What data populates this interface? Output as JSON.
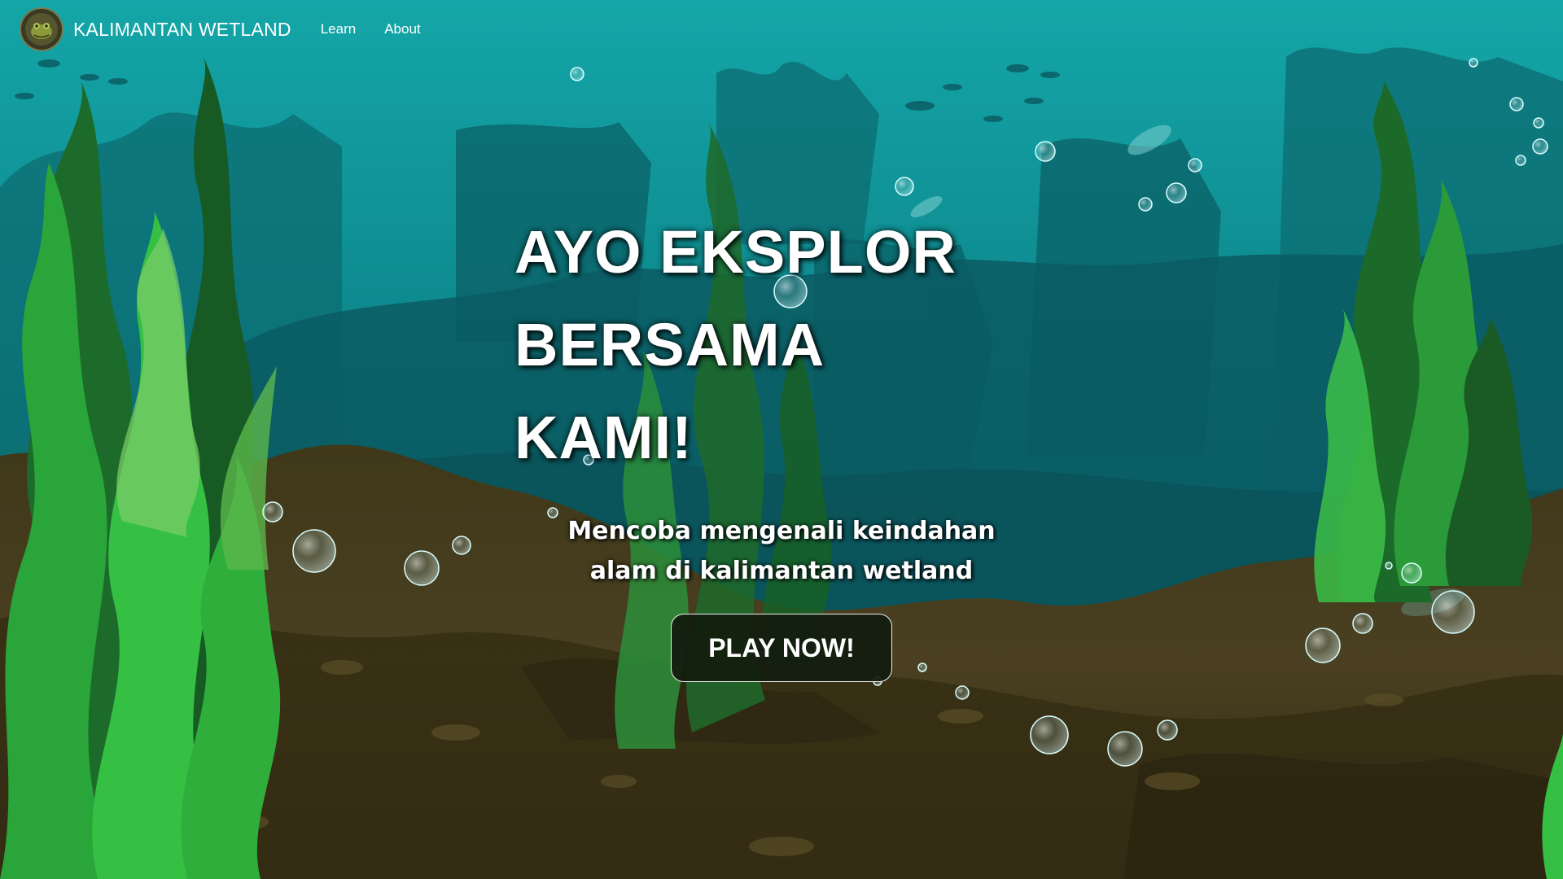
{
  "navbar": {
    "brand_name": "KALIMANTAN WETLAND",
    "logo_icon": "frog-logo-icon",
    "links": [
      {
        "label": "Learn"
      },
      {
        "label": "About"
      }
    ]
  },
  "hero": {
    "title_lines": [
      "AYO EKSPLOR",
      "BERSAMA",
      "KAMI!"
    ],
    "subtitle_lines": [
      "Mencoba mengenali keindahan",
      "alam di kalimantan wetland"
    ],
    "cta_label": "PLAY NOW!"
  },
  "colors": {
    "water_top": "#14a6a8",
    "water_deep": "#0b5f66",
    "seabed": "#4a3f1e",
    "seaweed_bright": "#2fbf3a",
    "seaweed_dark": "#1b5d2a",
    "button_bg": "#121c0e"
  }
}
